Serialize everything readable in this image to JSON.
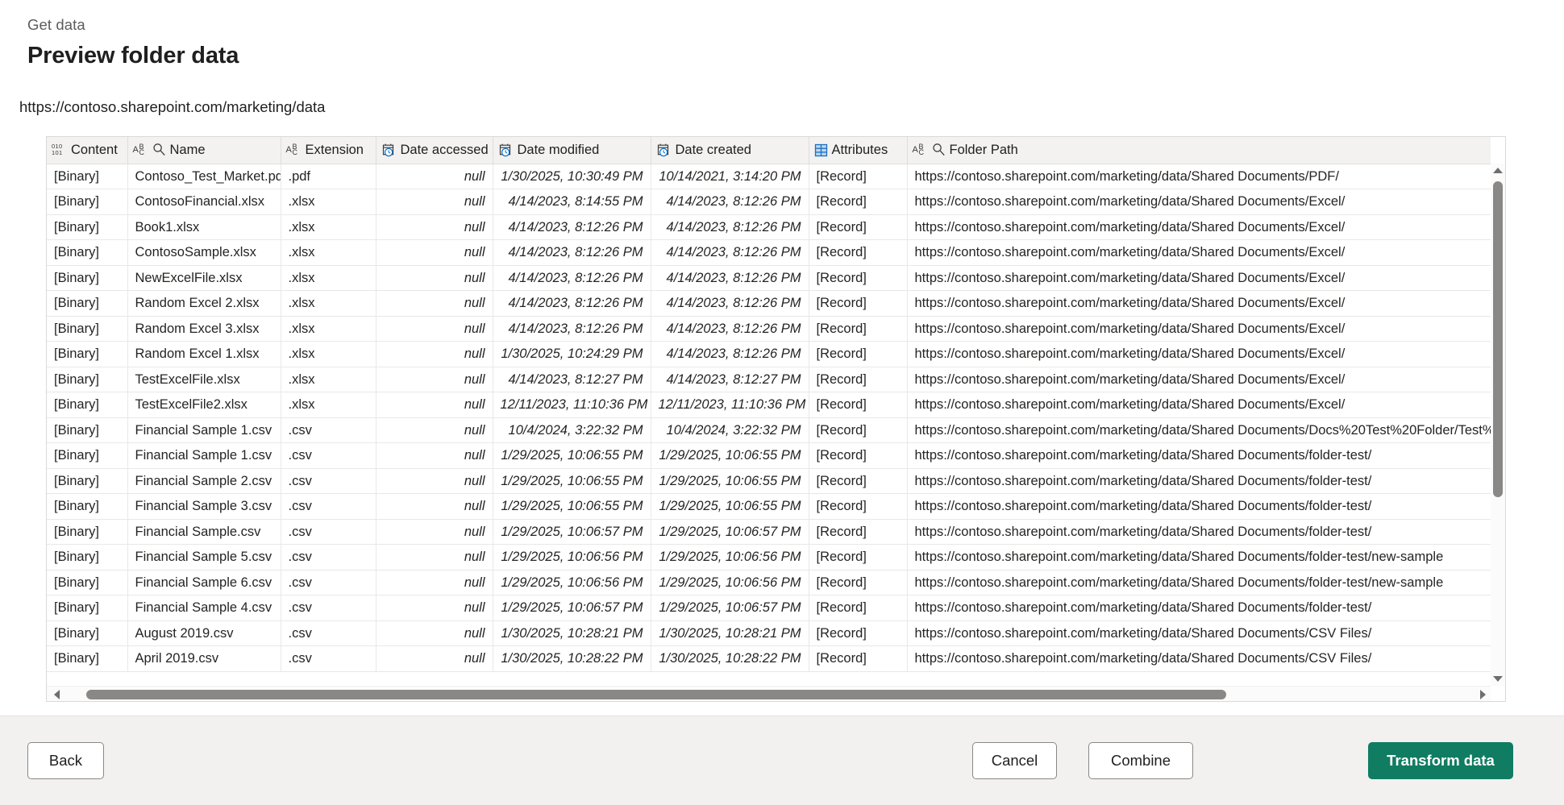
{
  "dialog": {
    "breadcrumb": "Get data",
    "title": "Preview folder data",
    "source_url": "https://contoso.sharepoint.com/marketing/data"
  },
  "colors": {
    "link": "#0f6b57",
    "primary_button": "#107c62",
    "header_fill": "#f3f2f1",
    "footer_fill": "#f2f1f0",
    "scrollbar_thumb": "#8a8886"
  },
  "table": {
    "columns": [
      {
        "label": "Content",
        "icon": "binary-type-icon",
        "align": "left"
      },
      {
        "label": "Name",
        "icon": "text-type-icon",
        "align": "left"
      },
      {
        "label": "Extension",
        "icon": "text-type-icon",
        "align": "left"
      },
      {
        "label": "Date accessed",
        "icon": "datetime-type-icon",
        "align": "left"
      },
      {
        "label": "Date modified",
        "icon": "datetime-type-icon",
        "align": "left"
      },
      {
        "label": "Date created",
        "icon": "datetime-type-icon",
        "align": "left"
      },
      {
        "label": "Attributes",
        "icon": "record-type-icon",
        "align": "left"
      },
      {
        "label": "Folder Path",
        "icon": "text-type-icon",
        "align": "left"
      }
    ],
    "rows": [
      {
        "content": "[Binary]",
        "name": "Contoso_Test_Market.pdf",
        "extension": ".pdf",
        "date_accessed": "null",
        "date_modified": "1/30/2025, 10:30:49 PM",
        "date_created": "10/14/2021, 3:14:20 PM",
        "attributes": "[Record]",
        "folder_path": "https://contoso.sharepoint.com/marketing/data/Shared Documents/PDF/"
      },
      {
        "content": "[Binary]",
        "name": "ContosoFinancial.xlsx",
        "extension": ".xlsx",
        "date_accessed": "null",
        "date_modified": "4/14/2023, 8:14:55 PM",
        "date_created": "4/14/2023, 8:12:26 PM",
        "attributes": "[Record]",
        "folder_path": "https://contoso.sharepoint.com/marketing/data/Shared Documents/Excel/"
      },
      {
        "content": "[Binary]",
        "name": "Book1.xlsx",
        "extension": ".xlsx",
        "date_accessed": "null",
        "date_modified": "4/14/2023, 8:12:26 PM",
        "date_created": "4/14/2023, 8:12:26 PM",
        "attributes": "[Record]",
        "folder_path": "https://contoso.sharepoint.com/marketing/data/Shared Documents/Excel/"
      },
      {
        "content": "[Binary]",
        "name": "ContosoSample.xlsx",
        "extension": ".xlsx",
        "date_accessed": "null",
        "date_modified": "4/14/2023, 8:12:26 PM",
        "date_created": "4/14/2023, 8:12:26 PM",
        "attributes": "[Record]",
        "folder_path": "https://contoso.sharepoint.com/marketing/data/Shared Documents/Excel/"
      },
      {
        "content": "[Binary]",
        "name": "NewExcelFile.xlsx",
        "extension": ".xlsx",
        "date_accessed": "null",
        "date_modified": "4/14/2023, 8:12:26 PM",
        "date_created": "4/14/2023, 8:12:26 PM",
        "attributes": "[Record]",
        "folder_path": "https://contoso.sharepoint.com/marketing/data/Shared Documents/Excel/"
      },
      {
        "content": "[Binary]",
        "name": "Random Excel 2.xlsx",
        "extension": ".xlsx",
        "date_accessed": "null",
        "date_modified": "4/14/2023, 8:12:26 PM",
        "date_created": "4/14/2023, 8:12:26 PM",
        "attributes": "[Record]",
        "folder_path": "https://contoso.sharepoint.com/marketing/data/Shared Documents/Excel/"
      },
      {
        "content": "[Binary]",
        "name": "Random Excel 3.xlsx",
        "extension": ".xlsx",
        "date_accessed": "null",
        "date_modified": "4/14/2023, 8:12:26 PM",
        "date_created": "4/14/2023, 8:12:26 PM",
        "attributes": "[Record]",
        "folder_path": "https://contoso.sharepoint.com/marketing/data/Shared Documents/Excel/"
      },
      {
        "content": "[Binary]",
        "name": "Random Excel 1.xlsx",
        "extension": ".xlsx",
        "date_accessed": "null",
        "date_modified": "1/30/2025, 10:24:29 PM",
        "date_created": "4/14/2023, 8:12:26 PM",
        "attributes": "[Record]",
        "folder_path": "https://contoso.sharepoint.com/marketing/data/Shared Documents/Excel/"
      },
      {
        "content": "[Binary]",
        "name": "TestExcelFile.xlsx",
        "extension": ".xlsx",
        "date_accessed": "null",
        "date_modified": "4/14/2023, 8:12:27 PM",
        "date_created": "4/14/2023, 8:12:27 PM",
        "attributes": "[Record]",
        "folder_path": "https://contoso.sharepoint.com/marketing/data/Shared Documents/Excel/"
      },
      {
        "content": "[Binary]",
        "name": "TestExcelFile2.xlsx",
        "extension": ".xlsx",
        "date_accessed": "null",
        "date_modified": "12/11/2023, 11:10:36 PM",
        "date_created": "12/11/2023, 11:10:36 PM",
        "attributes": "[Record]",
        "folder_path": "https://contoso.sharepoint.com/marketing/data/Shared Documents/Excel/"
      },
      {
        "content": "[Binary]",
        "name": "Financial Sample 1.csv",
        "extension": ".csv",
        "date_accessed": "null",
        "date_modified": "10/4/2024, 3:22:32 PM",
        "date_created": "10/4/2024, 3:22:32 PM",
        "attributes": "[Record]",
        "folder_path": "https://contoso.sharepoint.com/marketing/data/Shared Documents/Docs%20Test%20Folder/Test%…"
      },
      {
        "content": "[Binary]",
        "name": "Financial Sample 1.csv",
        "extension": ".csv",
        "date_accessed": "null",
        "date_modified": "1/29/2025, 10:06:55 PM",
        "date_created": "1/29/2025, 10:06:55 PM",
        "attributes": "[Record]",
        "folder_path": "https://contoso.sharepoint.com/marketing/data/Shared Documents/folder-test/"
      },
      {
        "content": "[Binary]",
        "name": "Financial Sample 2.csv",
        "extension": ".csv",
        "date_accessed": "null",
        "date_modified": "1/29/2025, 10:06:55 PM",
        "date_created": "1/29/2025, 10:06:55 PM",
        "attributes": "[Record]",
        "folder_path": "https://contoso.sharepoint.com/marketing/data/Shared Documents/folder-test/"
      },
      {
        "content": "[Binary]",
        "name": "Financial Sample 3.csv",
        "extension": ".csv",
        "date_accessed": "null",
        "date_modified": "1/29/2025, 10:06:55 PM",
        "date_created": "1/29/2025, 10:06:55 PM",
        "attributes": "[Record]",
        "folder_path": "https://contoso.sharepoint.com/marketing/data/Shared Documents/folder-test/"
      },
      {
        "content": "[Binary]",
        "name": "Financial Sample.csv",
        "extension": ".csv",
        "date_accessed": "null",
        "date_modified": "1/29/2025, 10:06:57 PM",
        "date_created": "1/29/2025, 10:06:57 PM",
        "attributes": "[Record]",
        "folder_path": "https://contoso.sharepoint.com/marketing/data/Shared Documents/folder-test/"
      },
      {
        "content": "[Binary]",
        "name": "Financial Sample 5.csv",
        "extension": ".csv",
        "date_accessed": "null",
        "date_modified": "1/29/2025, 10:06:56 PM",
        "date_created": "1/29/2025, 10:06:56 PM",
        "attributes": "[Record]",
        "folder_path": "https://contoso.sharepoint.com/marketing/data/Shared Documents/folder-test/new-sample"
      },
      {
        "content": "[Binary]",
        "name": "Financial Sample 6.csv",
        "extension": ".csv",
        "date_accessed": "null",
        "date_modified": "1/29/2025, 10:06:56 PM",
        "date_created": "1/29/2025, 10:06:56 PM",
        "attributes": "[Record]",
        "folder_path": "https://contoso.sharepoint.com/marketing/data/Shared Documents/folder-test/new-sample"
      },
      {
        "content": "[Binary]",
        "name": "Financial Sample 4.csv",
        "extension": ".csv",
        "date_accessed": "null",
        "date_modified": "1/29/2025, 10:06:57 PM",
        "date_created": "1/29/2025, 10:06:57 PM",
        "attributes": "[Record]",
        "folder_path": "https://contoso.sharepoint.com/marketing/data/Shared Documents/folder-test/"
      },
      {
        "content": "[Binary]",
        "name": "August 2019.csv",
        "extension": ".csv",
        "date_accessed": "null",
        "date_modified": "1/30/2025, 10:28:21 PM",
        "date_created": "1/30/2025, 10:28:21 PM",
        "attributes": "[Record]",
        "folder_path": "https://contoso.sharepoint.com/marketing/data/Shared Documents/CSV Files/"
      },
      {
        "content": "[Binary]",
        "name": "April 2019.csv",
        "extension": ".csv",
        "date_accessed": "null",
        "date_modified": "1/30/2025, 10:28:22 PM",
        "date_created": "1/30/2025, 10:28:22 PM",
        "attributes": "[Record]",
        "folder_path": "https://contoso.sharepoint.com/marketing/data/Shared Documents/CSV Files/"
      }
    ]
  },
  "footer": {
    "back_label": "Back",
    "cancel_label": "Cancel",
    "combine_label": "Combine",
    "transform_label": "Transform data"
  }
}
